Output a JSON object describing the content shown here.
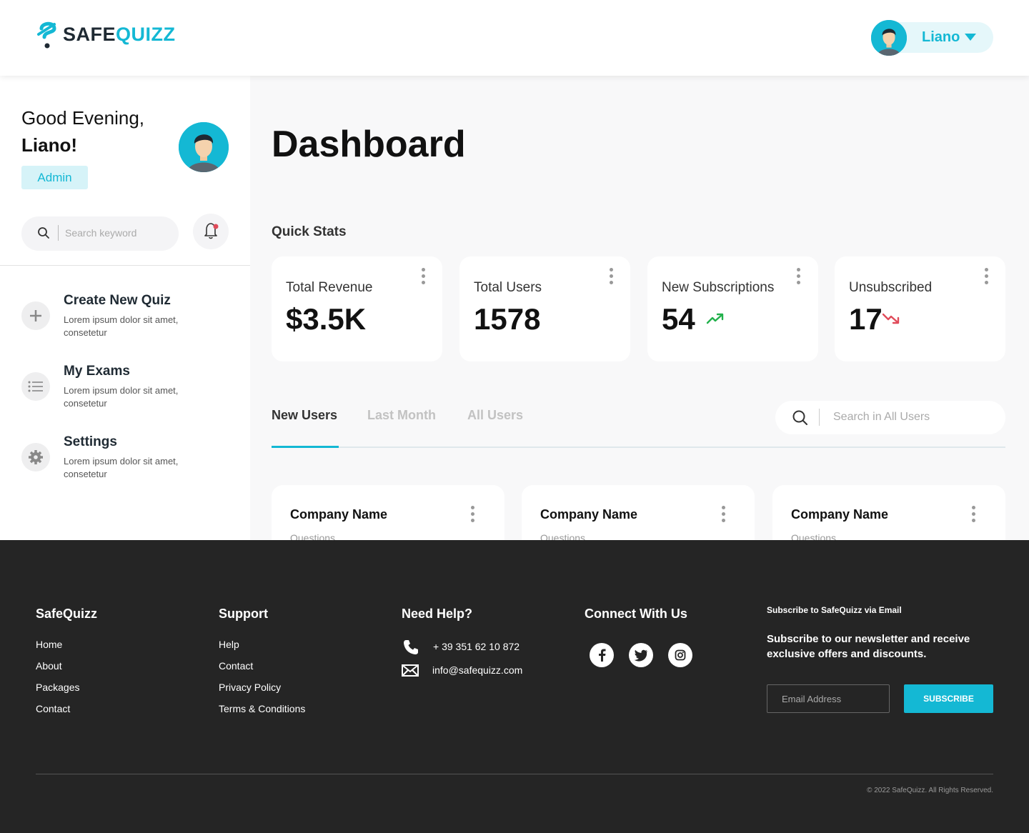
{
  "brand": {
    "logo_safe": "SAFE",
    "logo_quizz": "QUIZZ"
  },
  "header": {
    "user_name": "Liano"
  },
  "sidebar": {
    "greeting": "Good Evening,",
    "name": "Liano!",
    "role_badge": "Admin",
    "search_placeholder": "Search keyword",
    "menu": [
      {
        "title": "Create New Quiz",
        "desc": "Lorem ipsum dolor sit amet, consetetur",
        "icon": "plus-icon"
      },
      {
        "title": "My Exams",
        "desc": "Lorem ipsum dolor sit amet, consetetur",
        "icon": "list-icon"
      },
      {
        "title": "Settings",
        "desc": "Lorem ipsum dolor sit amet, consetetur",
        "icon": "gear-icon"
      }
    ]
  },
  "main": {
    "title": "Dashboard",
    "quick_stats_label": "Quick Stats",
    "stats": [
      {
        "label": "Total Revenue",
        "value": "$3.5K"
      },
      {
        "label": "Total Users",
        "value": "1578"
      },
      {
        "label": "New Subscriptions",
        "value": "54",
        "trend": "up"
      },
      {
        "label": "Unsubscribed",
        "value": "17",
        "trend": "down"
      }
    ],
    "tabs": [
      "New Users",
      "Last Month",
      "All Users"
    ],
    "user_search_placeholder": "Search in All Users",
    "companies": [
      {
        "name": "Company Name",
        "sub": "Questions"
      },
      {
        "name": "Company Name",
        "sub": "Questions"
      },
      {
        "name": "Company Name",
        "sub": "Questions"
      }
    ]
  },
  "footer": {
    "col1": {
      "heading": "SafeQuizz",
      "links": [
        "Home",
        "About",
        "Packages",
        "Contact"
      ]
    },
    "col2": {
      "heading": "Support",
      "links": [
        "Help",
        "Contact",
        "Privacy Policy",
        "Terms & Conditions"
      ]
    },
    "col3": {
      "heading": "Need Help?",
      "phone": "+ 39 351 62 10 872",
      "email": "info@safequizz.com"
    },
    "col4": {
      "heading": "Connect With Us"
    },
    "col5": {
      "heading": "Subscribe to SafeQuizz via Email",
      "text": "Subscribe to our newsletter and receive exclusive offers and discounts.",
      "email_placeholder": "Email Address",
      "button": "SUBSCRIBE"
    },
    "copyright": "© 2022 SafeQuizz. All Rights Reserved."
  },
  "colors": {
    "accent": "#14b8d4",
    "footer_bg": "#252525",
    "trend_up": "#22b14c",
    "trend_down": "#e04b5a"
  }
}
